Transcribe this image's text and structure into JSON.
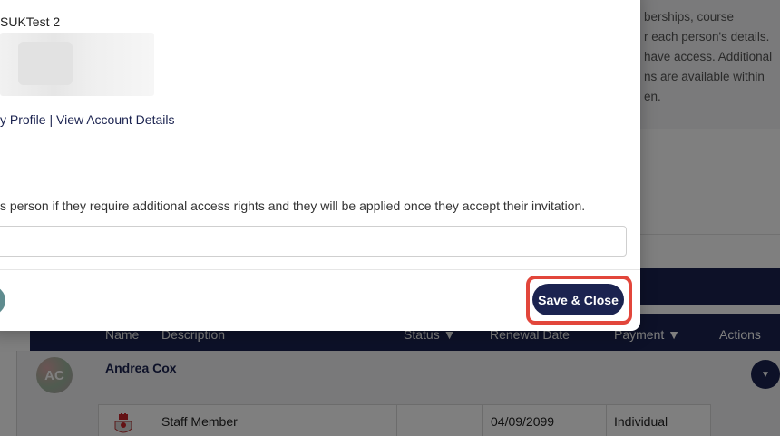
{
  "background": {
    "info_lines": [
      "berships, course",
      "r each person's details.",
      "have access. Additional",
      "ns are available within",
      "en."
    ],
    "table_headers": [
      "Name",
      "Description",
      "Status",
      "Renewal Date",
      "Payment",
      "Actions"
    ],
    "person": {
      "initials": "AC",
      "name": "Andrea Cox"
    },
    "membership_row": {
      "description": "Staff Member",
      "renewal_date": "04/09/2099",
      "payment": "Individual"
    }
  },
  "modal": {
    "member_name": "SUKTest 2",
    "link_profile": "y Profile",
    "link_separator": "|",
    "link_account": "View Account Details",
    "access_description": "s person if they require additional access rights and they will be applied once they accept their invitation.",
    "access_input_value": "",
    "save_button_label": "Save & Close"
  },
  "colors": {
    "navy": "#1b2350",
    "highlight": "#e2463b"
  }
}
